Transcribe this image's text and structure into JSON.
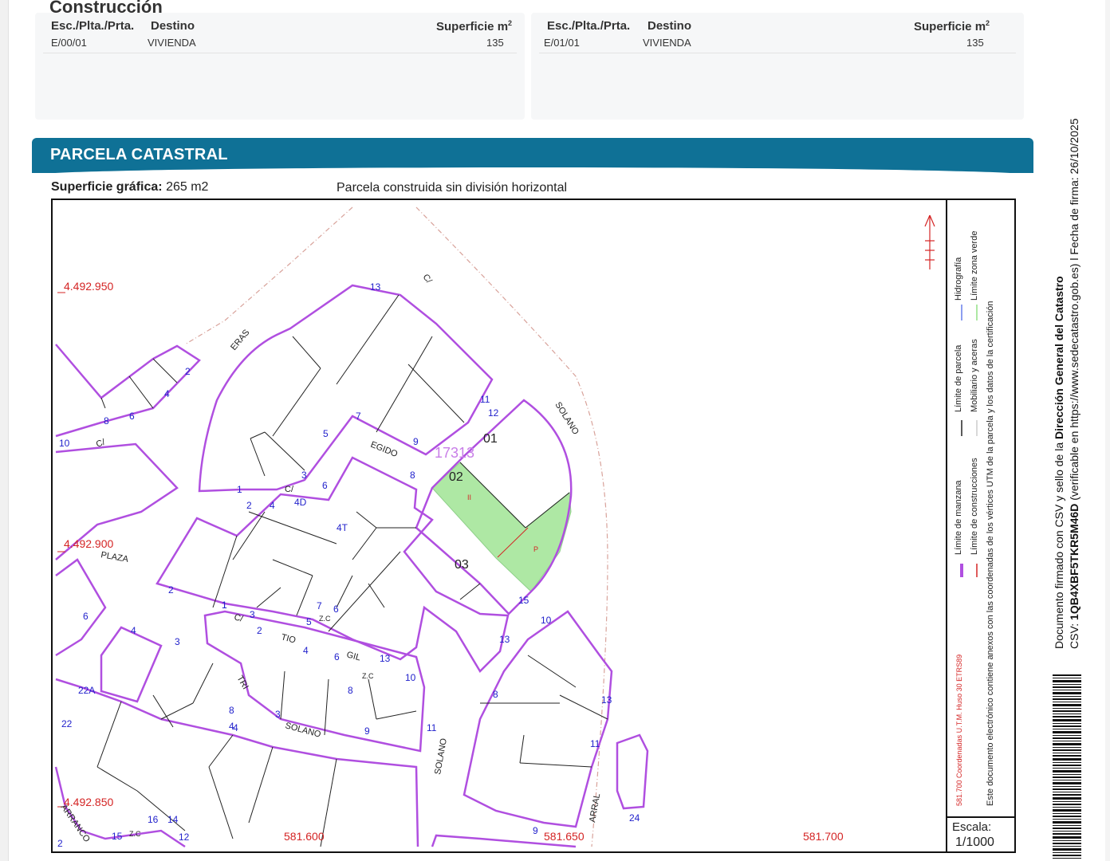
{
  "construction": {
    "title": "Construcción",
    "headers": {
      "esc": "Esc./Plta./Prta.",
      "destino": "Destino",
      "superficie": "Superficie m",
      "sup_unit_exp": "2"
    },
    "rows": [
      {
        "esc": "E/00/01",
        "destino": "VIVIENDA",
        "superficie": "135"
      },
      {
        "esc": "E/01/01",
        "destino": "VIVIENDA",
        "superficie": "135"
      }
    ]
  },
  "parcela": {
    "title": "PARCELA CATASTRAL",
    "superficie_label": "Superficie gráfica:",
    "superficie_value": "265 m2",
    "description": "Parcela construida sin división horizontal"
  },
  "map": {
    "parcel_ref": "17313",
    "subparcels": [
      "01",
      "02",
      "03"
    ],
    "coordinates": {
      "y_labels": [
        "4.492.950",
        "4.492.900",
        "4.492.850"
      ],
      "x_labels": [
        "581.600",
        "581.650",
        "581.700"
      ]
    },
    "street_labels": [
      "C/",
      "ERAS",
      "SOLANO",
      "EGIDO",
      "C/",
      "C/",
      "PLAZA",
      "C/",
      "TIO",
      "GIL",
      "Z.C",
      "Z.C",
      "Z.C",
      "SOLANO",
      "SOLANO",
      "TRI",
      "ARRANCO",
      "ARRAL"
    ],
    "house_numbers": [
      "13",
      "2",
      "4",
      "8",
      "6",
      "10",
      "11",
      "12",
      "7",
      "5",
      "9",
      "8",
      "3",
      "1",
      "6",
      "4D",
      "4T",
      "2",
      "4",
      "15",
      "13",
      "10",
      "13",
      "11",
      "8",
      "10",
      "11",
      "13",
      "1",
      "3",
      "2",
      "4",
      "5",
      "6",
      "4",
      "3",
      "6",
      "4",
      "7",
      "6",
      "8",
      "9",
      "9",
      "24",
      "16",
      "15",
      "14",
      "12",
      "2",
      "1",
      "22",
      "22A",
      "8",
      "4",
      "3",
      "2"
    ],
    "colors": {
      "manzana": "#b04fe0",
      "parcela": "#222222",
      "zona_verde": "#aee8a4",
      "label_blue": "#2222cc",
      "coord_red": "#d42424"
    }
  },
  "legend": {
    "items": [
      "Límite de manzana",
      "Límite de parcela",
      "Hidrografía",
      "Límite de construcciones",
      "Mobiliario y aceras",
      "Límite zona verde"
    ],
    "note": "Este documento electrónico contiene anexos con las coordenadas de los vértices UTM de la parcela y los datos de la certificación",
    "coords_note": "581.700 Coordenadas U.T.M. Huso 30 ETRS89",
    "scale_label": "Escala:",
    "scale_value": "1/1000"
  },
  "signature": {
    "line1_prefix": "Documento firmado con CSV y sello de la ",
    "line1_bold": "Dirección General del Catastro",
    "line2_prefix": "CSV: ",
    "line2_code": "1QB4XBF5TKR5M46D",
    "line2_suffix": " (verificable en https://www.sedecatastro.gob.es)",
    "line2_sep": "  l  Fecha de firma: 26/10/2025"
  }
}
